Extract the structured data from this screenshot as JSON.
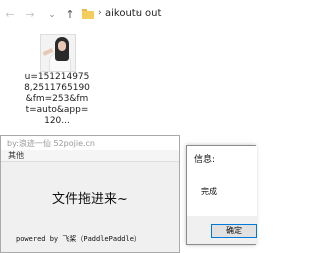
{
  "explorer": {
    "nav": {
      "back_icon": "←",
      "forward_icon": "→",
      "recent_icon": "⌄",
      "up_icon": "↑",
      "separator_icon": "›"
    },
    "breadcrumb": [
      "aikoutu",
      "out"
    ],
    "folder_color": "#f5cd5c",
    "file": {
      "name": "u=1512149758,2511765190&fm=253&fmt=auto&app=120..."
    }
  },
  "main_window": {
    "title": "by:浪迹一仙 52pojie.cn",
    "menu": [
      "其他"
    ],
    "drop_hint": "文件拖进来~",
    "powered_by": "powered by 飞桨（PaddlePaddle）"
  },
  "message_box": {
    "title": "信息:",
    "message": "完成",
    "ok_label": "确定",
    "accent": "#0078d7"
  }
}
